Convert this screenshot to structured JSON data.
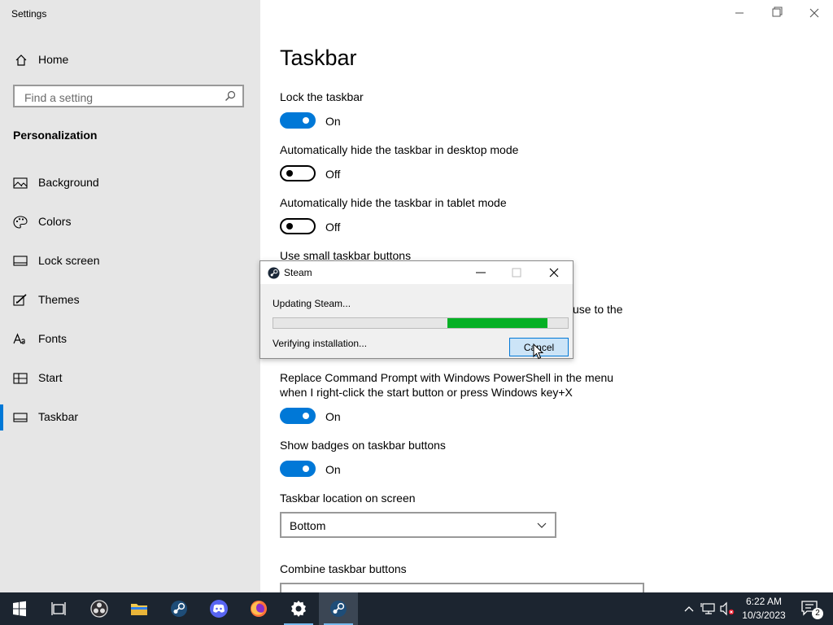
{
  "window": {
    "title": "Settings"
  },
  "sidebar": {
    "home_label": "Home",
    "search_placeholder": "Find a setting",
    "section": "Personalization",
    "items": [
      {
        "label": "Background",
        "icon": "image-icon"
      },
      {
        "label": "Colors",
        "icon": "palette-icon"
      },
      {
        "label": "Lock screen",
        "icon": "monitor-icon"
      },
      {
        "label": "Themes",
        "icon": "brush-icon"
      },
      {
        "label": "Fonts",
        "icon": "font-icon"
      },
      {
        "label": "Start",
        "icon": "start-grid-icon"
      },
      {
        "label": "Taskbar",
        "icon": "taskbar-icon",
        "active": true
      }
    ]
  },
  "main": {
    "title": "Taskbar",
    "settings": [
      {
        "label": "Lock the taskbar",
        "state": "On"
      },
      {
        "label": "Automatically hide the taskbar in desktop mode",
        "state": "Off"
      },
      {
        "label": "Automatically hide the taskbar in tablet mode",
        "state": "Off"
      },
      {
        "label": "Use small taskbar buttons"
      },
      {
        "partial_text": "use to the"
      },
      {
        "label_line1": "Replace Command Prompt with Windows PowerShell in the menu",
        "label_line2": "when I right-click the start button or press Windows key+X",
        "state": "On"
      },
      {
        "label": "Show badges on taskbar buttons",
        "state": "On"
      }
    ],
    "location_label": "Taskbar location on screen",
    "location_value": "Bottom",
    "combine_label": "Combine taskbar buttons"
  },
  "dialog": {
    "title": "Steam",
    "message": "Updating Steam...",
    "progress": {
      "start": 0.59,
      "end": 0.93
    },
    "status": "Verifying installation...",
    "cancel_label": "Cancel"
  },
  "taskbar": {
    "apps": [
      "start-button",
      "task-view",
      "obs",
      "file-explorer",
      "steam",
      "discord",
      "firefox",
      "settings",
      "steam"
    ],
    "time": "6:22 AM",
    "date": "10/3/2023",
    "notification_count": "2"
  },
  "colors": {
    "accent": "#0078d7",
    "progress": "#06b025",
    "taskbar": "#1c2530"
  }
}
